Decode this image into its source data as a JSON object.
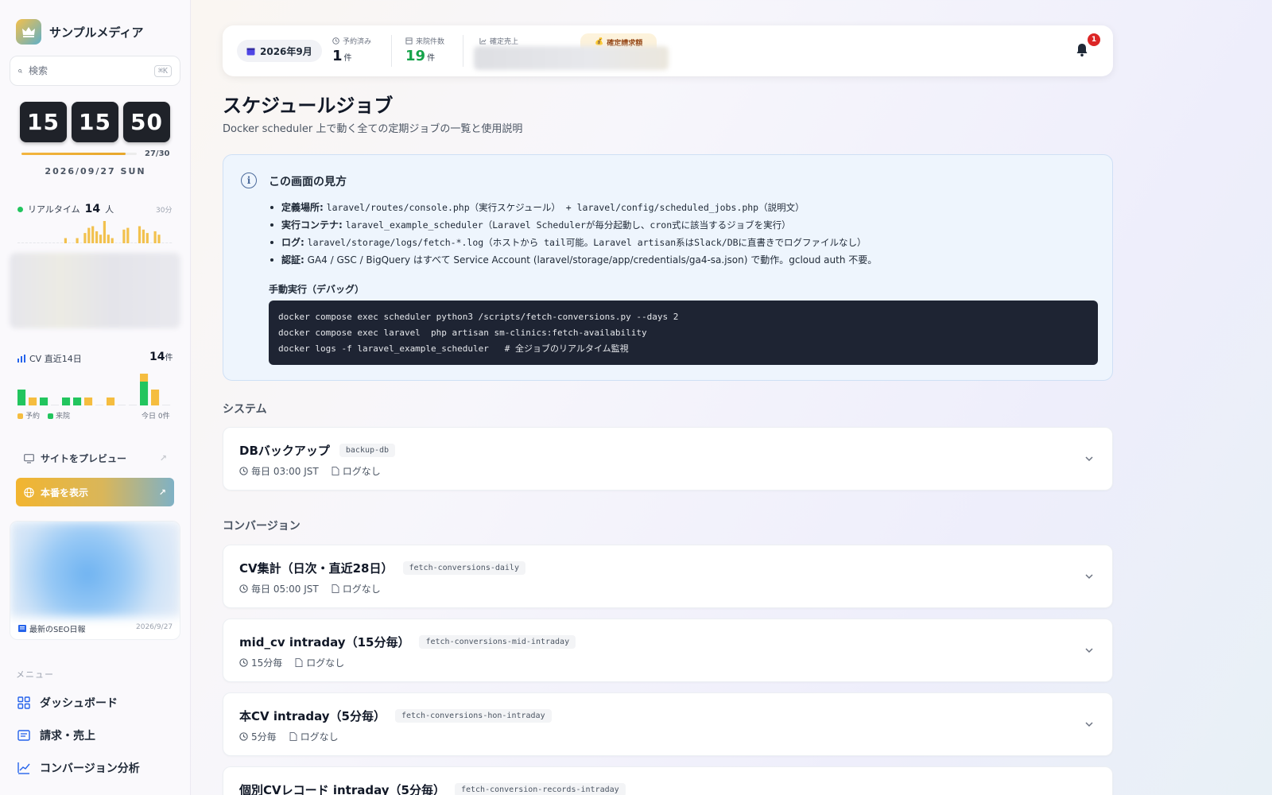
{
  "sidebar": {
    "brand_name": "サンプルメディア",
    "search_placeholder": "検索",
    "search_shortcut": "⌘K",
    "clock": {
      "hours": "15",
      "minutes": "15",
      "seconds": "50",
      "progress": "27/30",
      "progress_fraction": 0.9,
      "date": "2026/09/27 SUN"
    },
    "realtime": {
      "label": "リアルタイム",
      "count": "14",
      "unit": "人",
      "window": "30分",
      "bars": [
        0,
        0,
        0,
        0,
        0,
        0,
        0,
        0,
        0,
        0,
        0,
        0,
        3,
        0,
        0,
        3,
        0,
        6,
        9,
        10,
        7,
        5,
        13,
        5,
        3,
        0,
        0,
        8,
        9,
        0,
        0,
        10,
        8,
        6,
        0,
        7,
        5,
        0,
        0,
        0
      ]
    },
    "cv": {
      "label": "CV 直近14日",
      "total": "14",
      "unit": "件",
      "legend_reserve": "予約",
      "legend_visit": "来院",
      "today": "今日 0件",
      "days": [
        {
          "reserve": 0,
          "visit": 2
        },
        {
          "reserve": 1,
          "visit": 0
        },
        {
          "reserve": 0,
          "visit": 1
        },
        {
          "reserve": 0,
          "visit": 0
        },
        {
          "reserve": 0,
          "visit": 1
        },
        {
          "reserve": 0,
          "visit": 1
        },
        {
          "reserve": 1,
          "visit": 0
        },
        {
          "reserve": 0,
          "visit": 0
        },
        {
          "reserve": 1,
          "visit": 0
        },
        {
          "reserve": 0,
          "visit": 0
        },
        {
          "reserve": 0,
          "visit": 0
        },
        {
          "reserve": 1,
          "visit": 3
        },
        {
          "reserve": 2,
          "visit": 0
        },
        {
          "reserve": 0,
          "visit": 0
        }
      ]
    },
    "preview_label": "サイトをプレビュー",
    "production_label": "本番を表示",
    "seo": {
      "title": "最新のSEO日報",
      "date": "2026/9/27"
    },
    "menu_heading": "メニュー",
    "menu": [
      {
        "label": "ダッシュボード",
        "icon": "grid-icon"
      },
      {
        "label": "請求・売上",
        "icon": "invoice-icon"
      },
      {
        "label": "コンバージョン分析",
        "icon": "chart-line-icon"
      }
    ],
    "colors": {
      "reserve": "#f5bd3f",
      "visit": "#22c55e",
      "realtime_bar": "#f2c14e"
    }
  },
  "topbar": {
    "month": "2026年9月",
    "reserved_label": "予約済み",
    "reserved_value": "1",
    "reserved_unit": "件",
    "visits_label": "来院件数",
    "visits_value": "19",
    "visits_unit": "件",
    "sales_label": "確定売上",
    "billing_label": "確定請求額",
    "notification_count": "1"
  },
  "page": {
    "title": "スケジュールジョブ",
    "subtitle": "Docker scheduler 上で動く全ての定期ジョブの一覧と使用説明"
  },
  "info": {
    "title": "この画面の見方",
    "items": [
      {
        "label": "定義場所:",
        "text": "laravel/routes/console.php（実行スケジュール） + laravel/config/scheduled_jobs.php（説明文）"
      },
      {
        "label": "実行コンテナ:",
        "text": "laravel_example_scheduler（Laravel Schedulerが毎分起動し、cron式に該当するジョブを実行）"
      },
      {
        "label": "ログ:",
        "text": "laravel/storage/logs/fetch-*.log（ホストから tail可能。Laravel artisan系はSlack/DBに直書きでログファイルなし）"
      },
      {
        "label": "認証:",
        "text": "GA4 / GSC / BigQuery はすべて Service Account (laravel/storage/app/credentials/ga4-sa.json) で動作。gcloud auth 不要。"
      }
    ],
    "manual_title": "手動実行（デバッグ）",
    "code": [
      "docker compose exec scheduler python3 /scripts/fetch-conversions.py --days 2",
      "docker compose exec laravel  php artisan sm-clinics:fetch-availability",
      "docker logs -f laravel_example_scheduler   # 全ジョブのリアルタイム監視"
    ]
  },
  "sections": {
    "system": "システム",
    "conversion": "コンバージョン"
  },
  "jobs": [
    {
      "title": "DBバックアップ",
      "tag": "backup-db",
      "schedule": "毎日 03:00 JST",
      "log": "ログなし"
    },
    {
      "title": "CV集計（日次・直近28日）",
      "tag": "fetch-conversions-daily",
      "schedule": "毎日 05:00 JST",
      "log": "ログなし"
    },
    {
      "title": "mid_cv intraday（15分毎）",
      "tag": "fetch-conversions-mid-intraday",
      "schedule": "15分毎",
      "log": "ログなし"
    },
    {
      "title": "本CV intraday（5分毎）",
      "tag": "fetch-conversions-hon-intraday",
      "schedule": "5分毎",
      "log": "ログなし"
    },
    {
      "title": "個別CVレコード intraday（5分毎）",
      "tag": "fetch-conversion-records-intraday",
      "schedule": "",
      "log": ""
    }
  ]
}
